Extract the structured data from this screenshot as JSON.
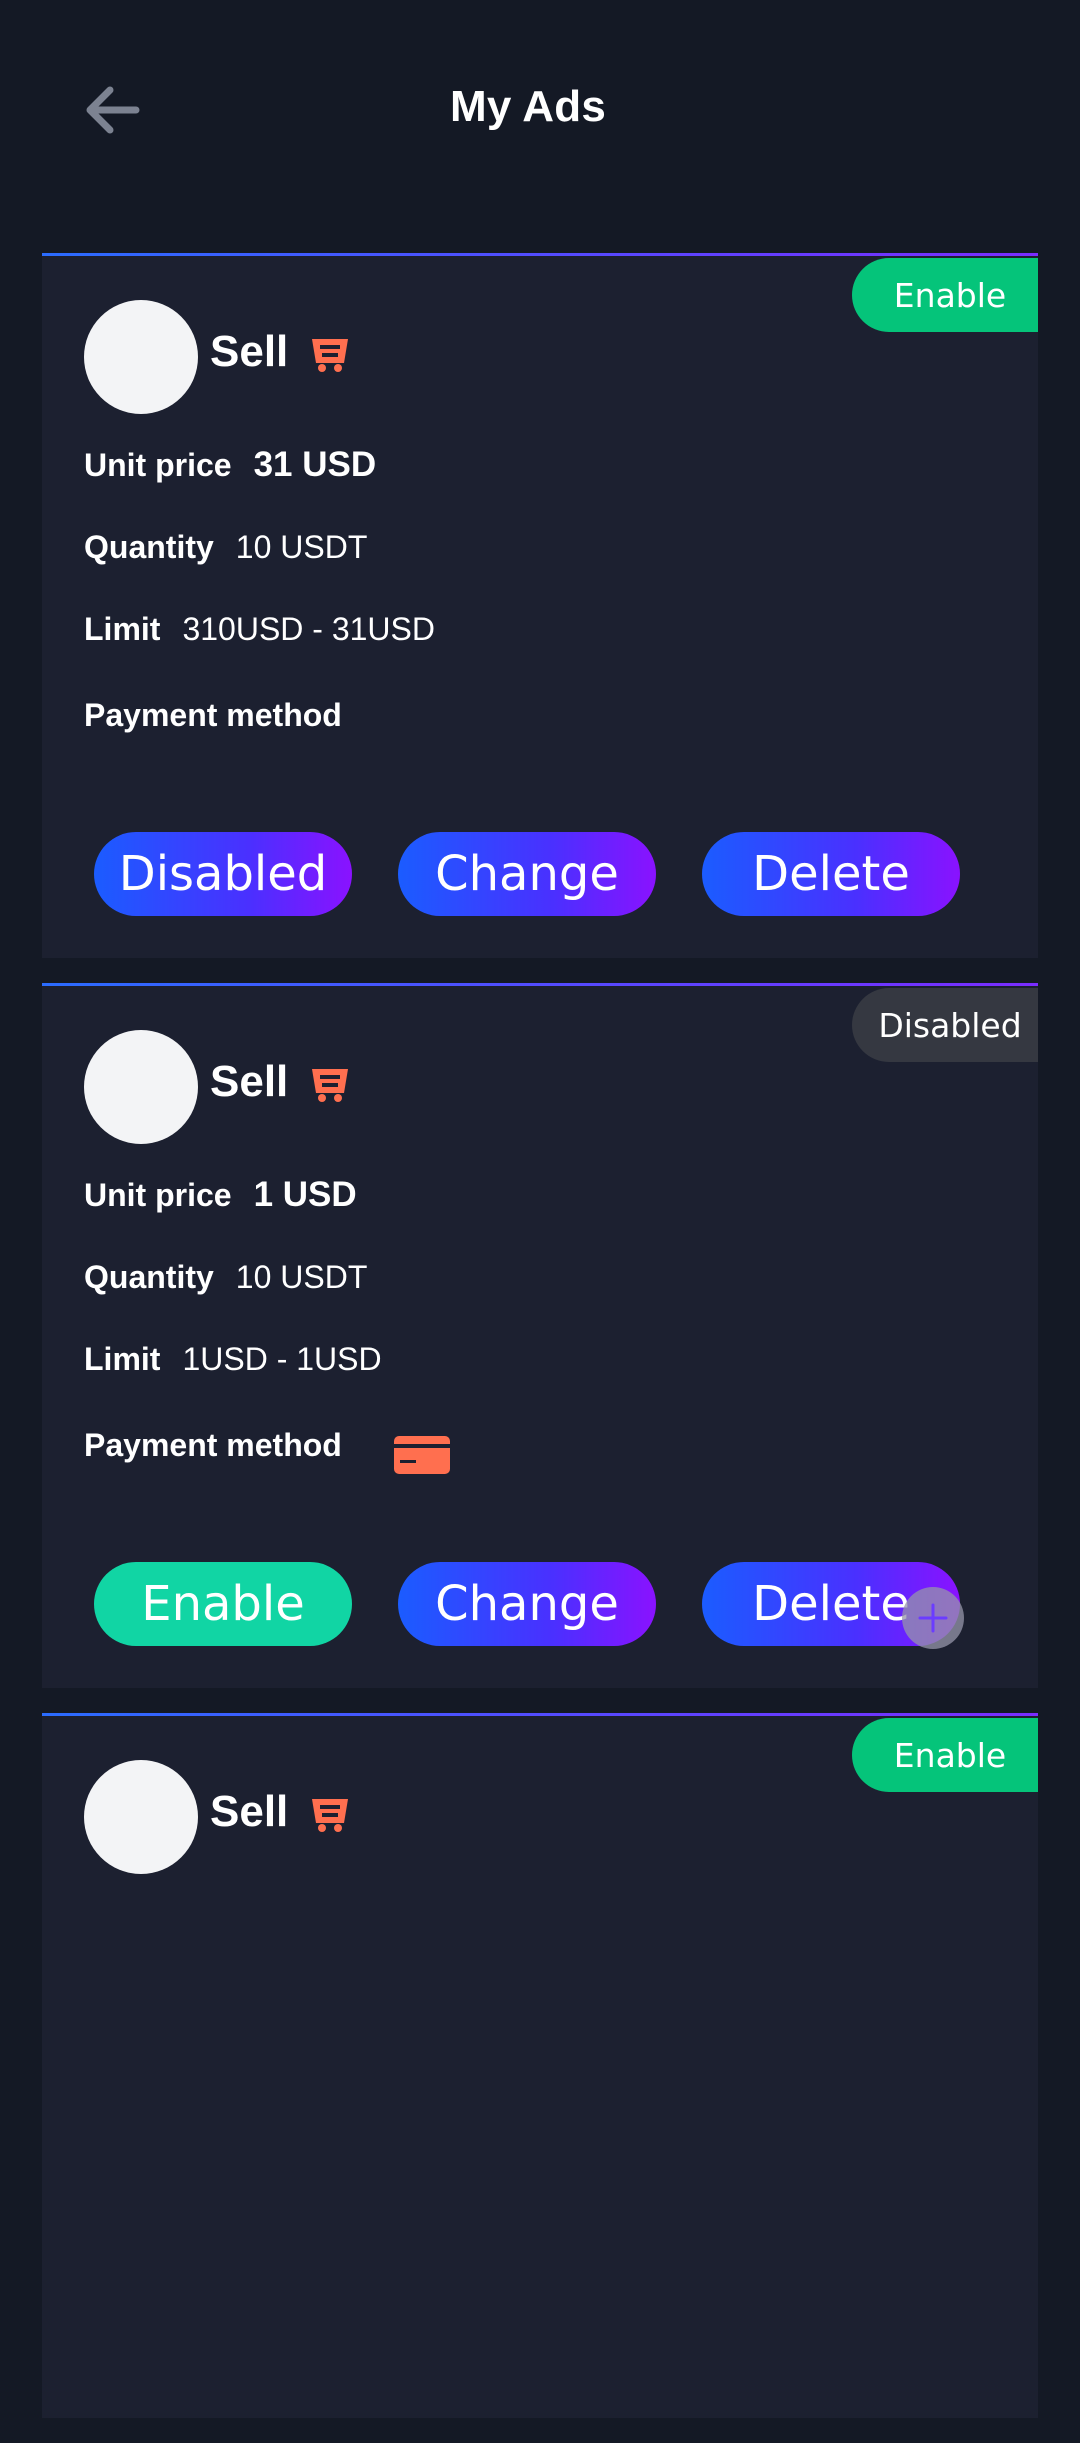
{
  "header": {
    "title": "My Ads",
    "back_icon": "arrow-left-icon"
  },
  "colors": {
    "background": "#141925",
    "card": "#1c2030",
    "accent_start": "#1b5cff",
    "accent_end": "#8a12ff",
    "enable_green": "#05c47a",
    "button_green": "#11d5a4",
    "icon_orange": "#ff6f4f"
  },
  "labels": {
    "unit_price": "Unit price",
    "quantity": "Quantity",
    "limit": "Limit",
    "payment_method": "Payment method"
  },
  "ads": [
    {
      "status": "Enable",
      "side": "Sell",
      "unit_price": "31  USD",
      "quantity": "10 USDT",
      "limit": "310USD - 31USD",
      "payment_icon": "",
      "buttons": [
        "Disabled",
        "Change",
        "Delete"
      ]
    },
    {
      "status": "Disabled",
      "side": "Sell",
      "unit_price": "1  USD",
      "quantity": "10 USDT",
      "limit": "1USD - 1USD",
      "payment_icon": "credit-card-icon",
      "buttons": [
        "Enable",
        "Change",
        "Delete"
      ]
    },
    {
      "status": "Enable",
      "side": "Sell"
    }
  ],
  "fab_icon": "plus-icon"
}
